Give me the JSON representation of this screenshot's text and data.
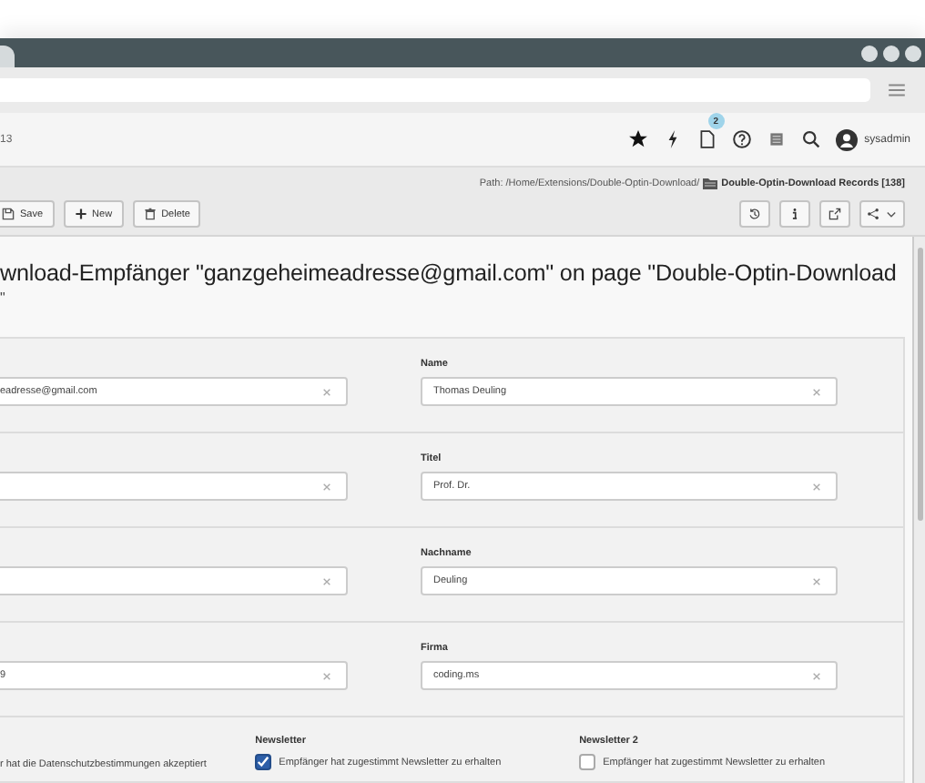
{
  "topbar": {
    "site_label": "13",
    "notification_badge": "2",
    "user": "sysadmin"
  },
  "docheader": {
    "path_prefix": "Path: /Home/Extensions/Double-Optin-Download/",
    "path_record": "Double-Optin-Download Records [138]",
    "buttons": [
      {
        "kind": "save",
        "label": "Save"
      },
      {
        "kind": "new",
        "label": "New"
      },
      {
        "kind": "delete",
        "label": "Delete"
      }
    ]
  },
  "title_lines": [
    "wnload-Empfänger \"ganzgeheimeadresse@gmail.com\" on page \"Double-Optin-Download",
    "\""
  ],
  "form_rows": [
    {
      "fields": [
        {
          "kind": "text",
          "value": "eadresse@gmail.com"
        },
        {
          "kind": "text",
          "label": "Name",
          "value": "Thomas Deuling"
        }
      ]
    },
    {
      "fields": [
        {
          "kind": "text"
        },
        {
          "kind": "text",
          "label": "Titel",
          "value": "Prof. Dr."
        }
      ]
    },
    {
      "fields": [
        {
          "kind": "text"
        },
        {
          "kind": "text",
          "label": "Nachname",
          "value": "Deuling"
        }
      ]
    },
    {
      "fields": [
        {
          "kind": "text",
          "value": "9"
        },
        {
          "kind": "text",
          "label": "Firma",
          "value": "coding.ms"
        }
      ]
    }
  ],
  "checkboxes": [
    {
      "kind": "text",
      "text": "r hat die Datenschutzbestimmungen akzeptiert"
    },
    {
      "kind": "checkbox",
      "label": "Newsletter",
      "text": "Empfänger hat zugestimmt Newsletter zu erhalten",
      "checked": true
    },
    {
      "kind": "checkbox",
      "label": "Newsletter 2",
      "text": "Empfänger hat zugestimmt Newsletter zu erhalten",
      "checked": false
    }
  ]
}
